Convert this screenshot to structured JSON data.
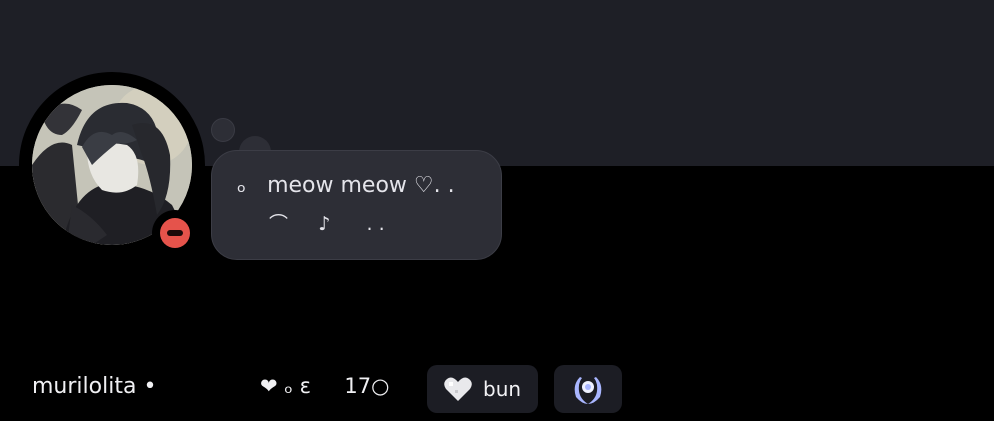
{
  "profile": {
    "username": "murilolita",
    "username_separator": "•",
    "status": "do-not-disturb",
    "status_color": "#e5534b",
    "stats_text": "❤ ₒ ɛ     17○",
    "custom_status": {
      "line1": "ₒ   meow meow ♡. .",
      "line2": "⌒     ♪      . ."
    },
    "server_tag": {
      "icon": "white-heart-icon",
      "label": "bun"
    },
    "badge": {
      "icon": "laurel-wreath-icon",
      "color": "#a9b6ff"
    }
  },
  "colors": {
    "banner": "#1e1f26",
    "background": "#000000",
    "bubble": "#2d2e36"
  }
}
